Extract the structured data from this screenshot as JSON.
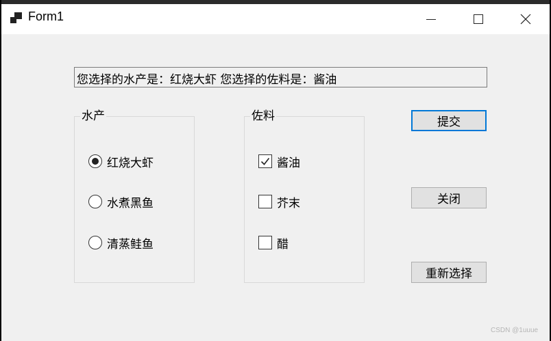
{
  "window": {
    "title": "Form1"
  },
  "result": {
    "text": "您选择的水产是：红烧大虾 您选择的佐料是：酱油"
  },
  "seafood": {
    "title": "水产",
    "options": [
      {
        "label": "红烧大虾",
        "selected": true
      },
      {
        "label": "水煮黑鱼",
        "selected": false
      },
      {
        "label": "清蒸鲑鱼",
        "selected": false
      }
    ]
  },
  "seasoning": {
    "title": "佐料",
    "options": [
      {
        "label": "酱油",
        "checked": true
      },
      {
        "label": "芥末",
        "checked": false
      },
      {
        "label": "醋",
        "checked": false
      }
    ]
  },
  "buttons": {
    "submit": "提交",
    "close": "关闭",
    "reset": "重新选择"
  },
  "watermark": "CSDN @1uuue"
}
